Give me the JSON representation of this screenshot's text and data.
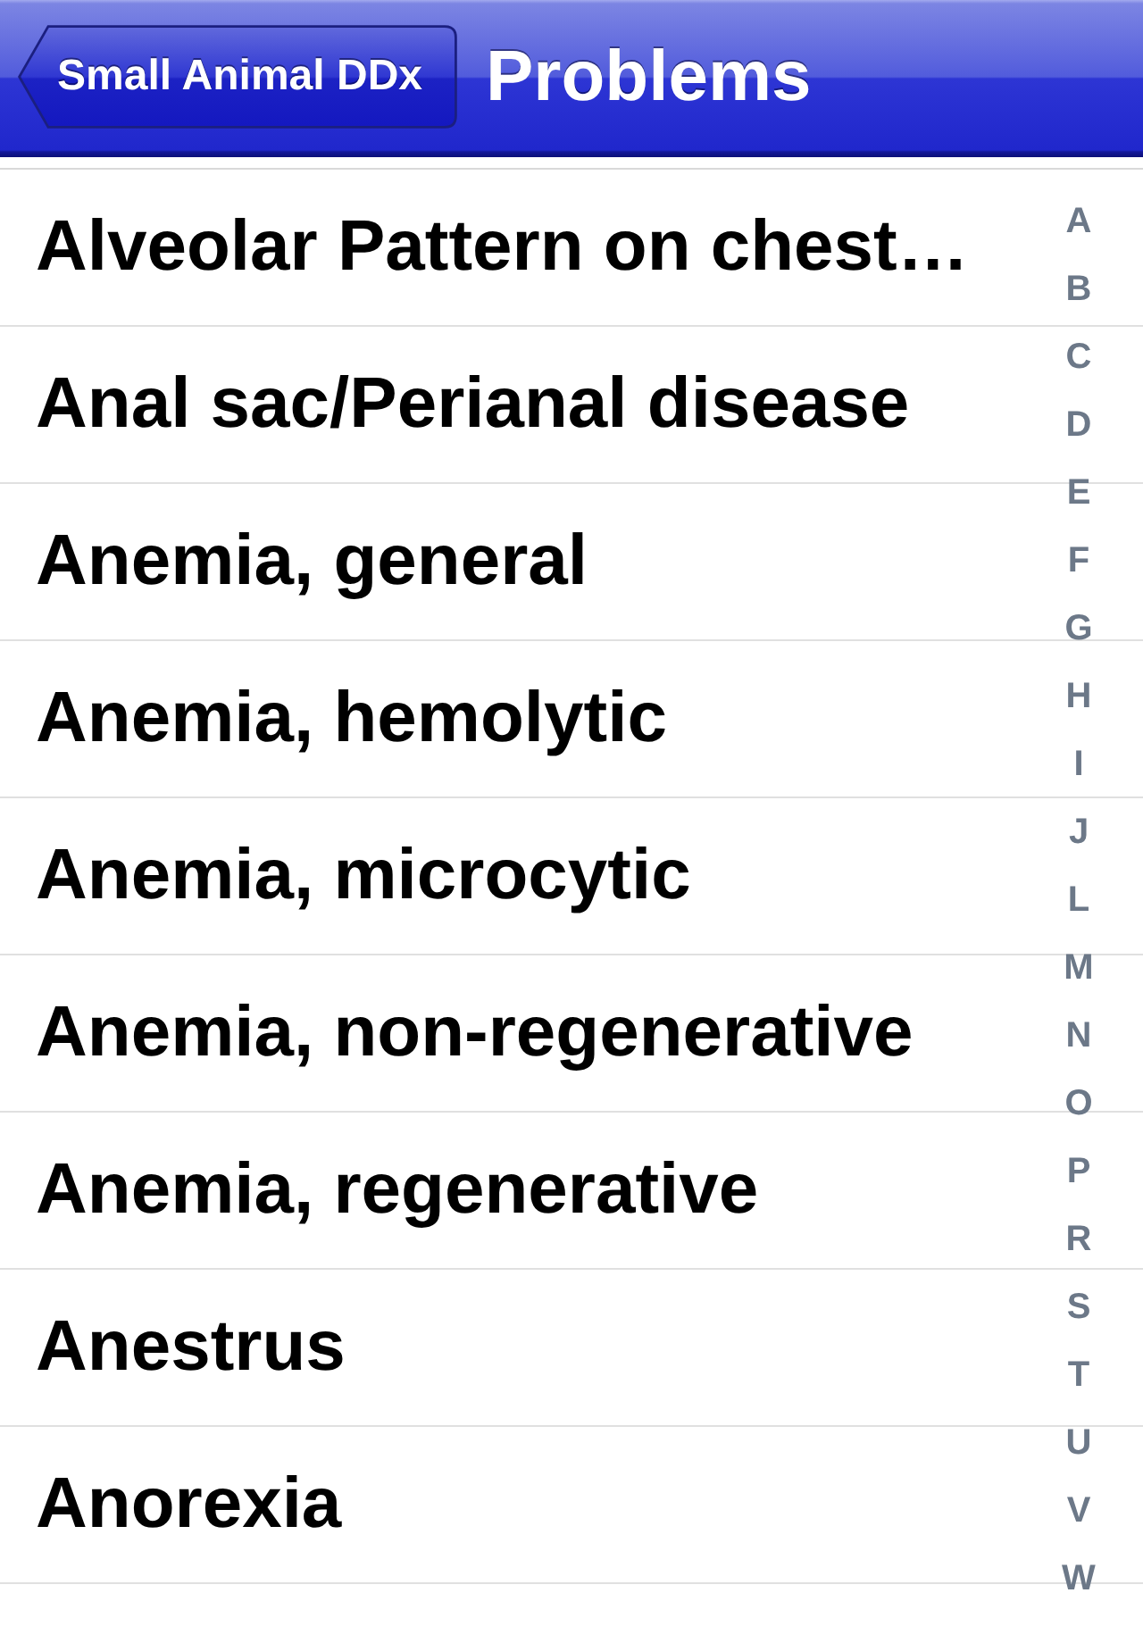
{
  "nav_bar": {
    "back_button": "Small Animal DDx",
    "title": "Problems"
  },
  "rows": [
    "Alveolar Pattern on chest…",
    "Anal sac/Perianal disease",
    "Anemia, general",
    "Anemia, hemolytic",
    "Anemia, microcytic",
    "Anemia, non-regenerative",
    "Anemia, regenerative",
    "Anestrus",
    "Anorexia"
  ],
  "section_index": [
    "A",
    "B",
    "C",
    "D",
    "E",
    "F",
    "G",
    "H",
    "I",
    "J",
    "L",
    "M",
    "N",
    "O",
    "P",
    "R",
    "S",
    "T",
    "U",
    "V",
    "W"
  ]
}
